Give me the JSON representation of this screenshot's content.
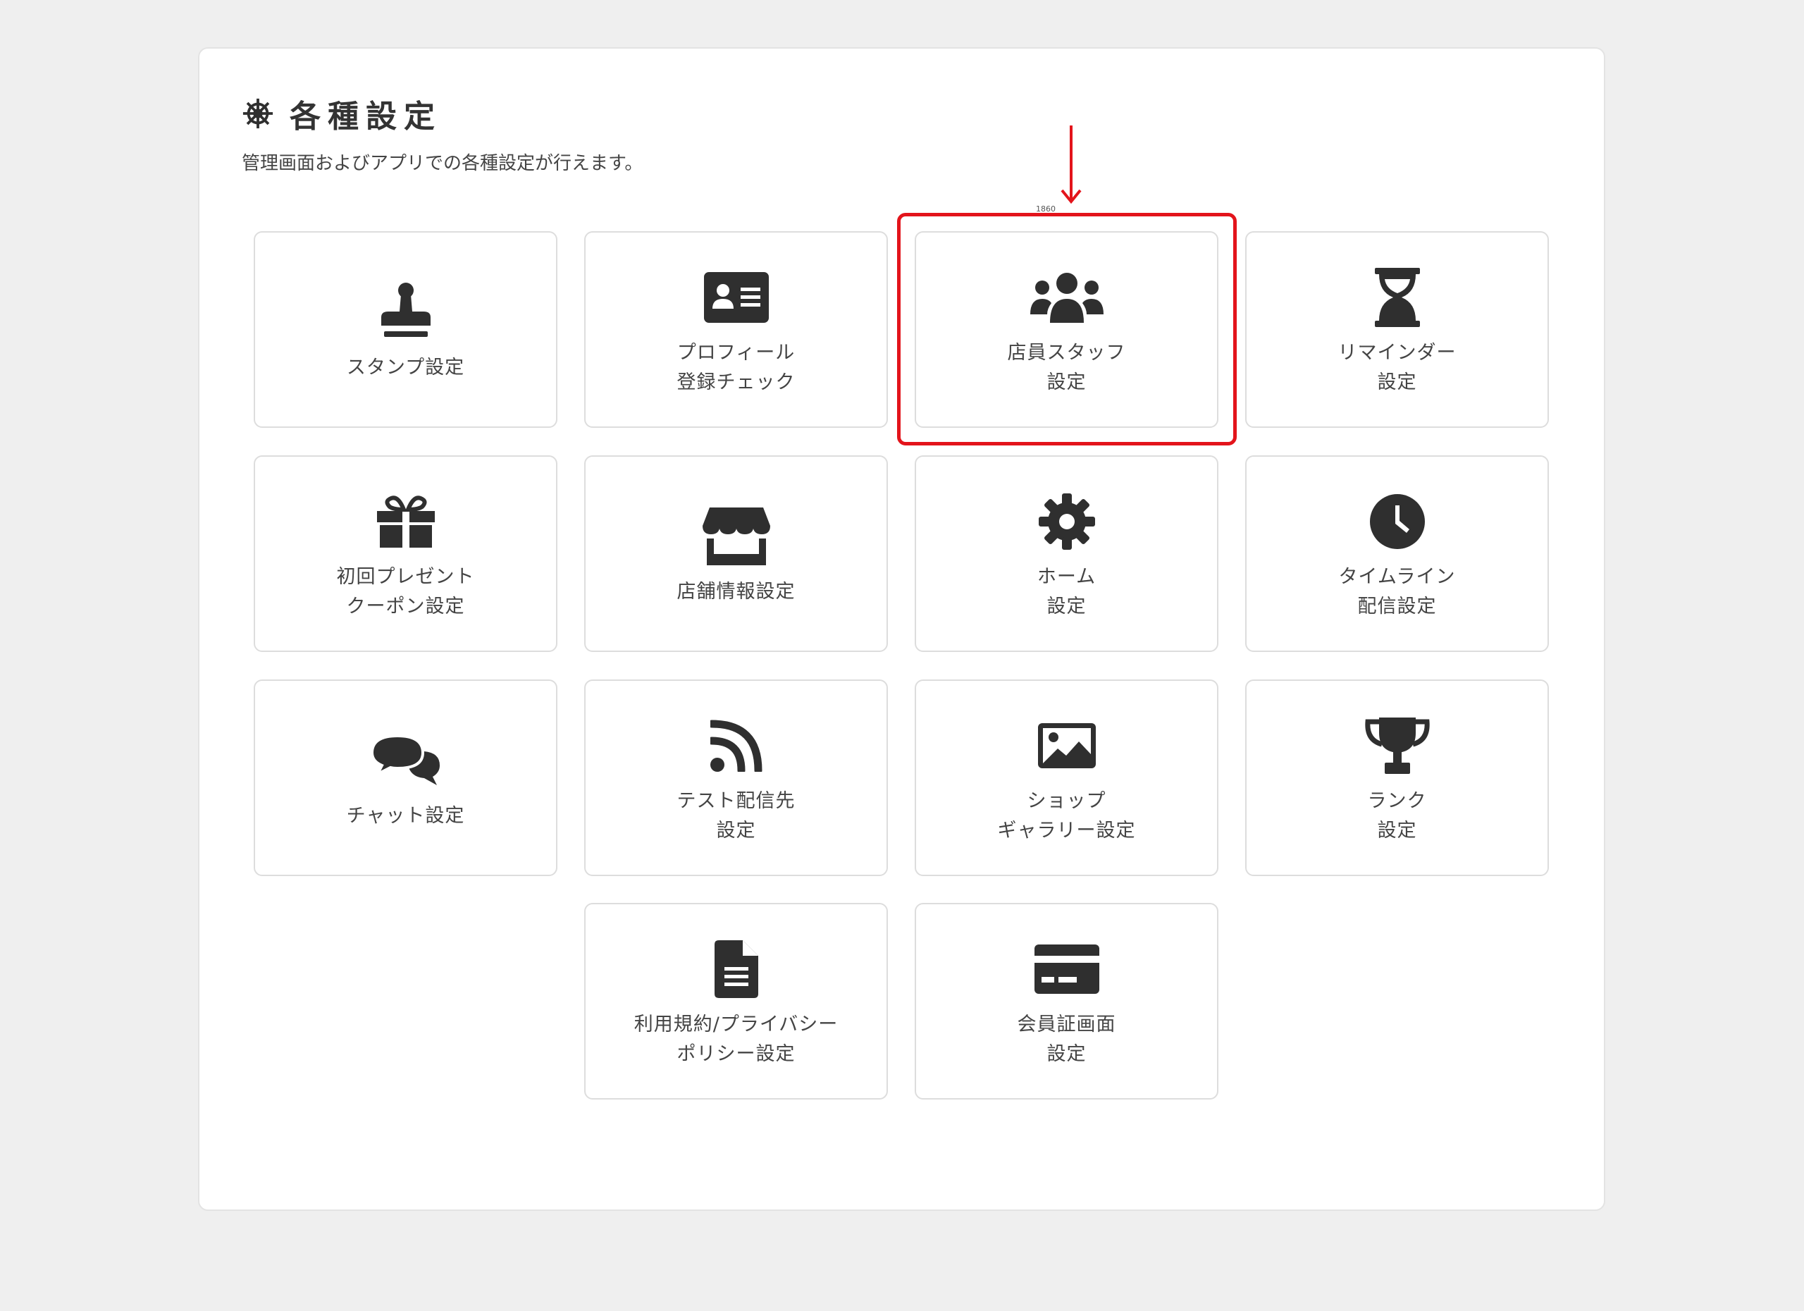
{
  "header": {
    "title": "各種設定",
    "subtitle": "管理画面およびアプリでの各種設定が行えます。",
    "icon": "helm-icon"
  },
  "annotation": {
    "label": "1860",
    "highlight_color": "#e3141b"
  },
  "colors": {
    "icon": "#2f2f2f",
    "text": "#444444",
    "card_border": "#dddddd",
    "background": "#efefef"
  },
  "cards": [
    {
      "name": "stamp",
      "icon": "stamp-icon",
      "line1": "スタンプ設定",
      "line2": ""
    },
    {
      "name": "profile",
      "icon": "id-card-icon",
      "line1": "プロフィール",
      "line2": "登録チェック"
    },
    {
      "name": "staff",
      "icon": "users-icon",
      "line1": "店員スタッフ",
      "line2": "設定"
    },
    {
      "name": "reminder",
      "icon": "hourglass-icon",
      "line1": "リマインダー",
      "line2": "設定"
    },
    {
      "name": "first-coupon",
      "icon": "gift-icon",
      "line1": "初回プレゼント",
      "line2": "クーポン設定"
    },
    {
      "name": "store-info",
      "icon": "store-icon",
      "line1": "店舗情報設定",
      "line2": ""
    },
    {
      "name": "home",
      "icon": "gear-icon",
      "line1": "ホーム",
      "line2": "設定"
    },
    {
      "name": "timeline",
      "icon": "clock-icon",
      "line1": "タイムライン",
      "line2": "配信設定"
    },
    {
      "name": "chat",
      "icon": "chat-icon",
      "line1": "チャット設定",
      "line2": ""
    },
    {
      "name": "test-delivery",
      "icon": "rss-icon",
      "line1": "テスト配信先",
      "line2": "設定"
    },
    {
      "name": "shop-gallery",
      "icon": "image-icon",
      "line1": "ショップ",
      "line2": "ギャラリー設定"
    },
    {
      "name": "rank",
      "icon": "trophy-icon",
      "line1": "ランク",
      "line2": "設定"
    },
    {
      "name": "terms",
      "icon": "document-icon",
      "line1": "利用規約/プライバシー",
      "line2": "ポリシー設定"
    },
    {
      "name": "member-card",
      "icon": "credit-card-icon",
      "line1": "会員証画面",
      "line2": "設定"
    }
  ]
}
